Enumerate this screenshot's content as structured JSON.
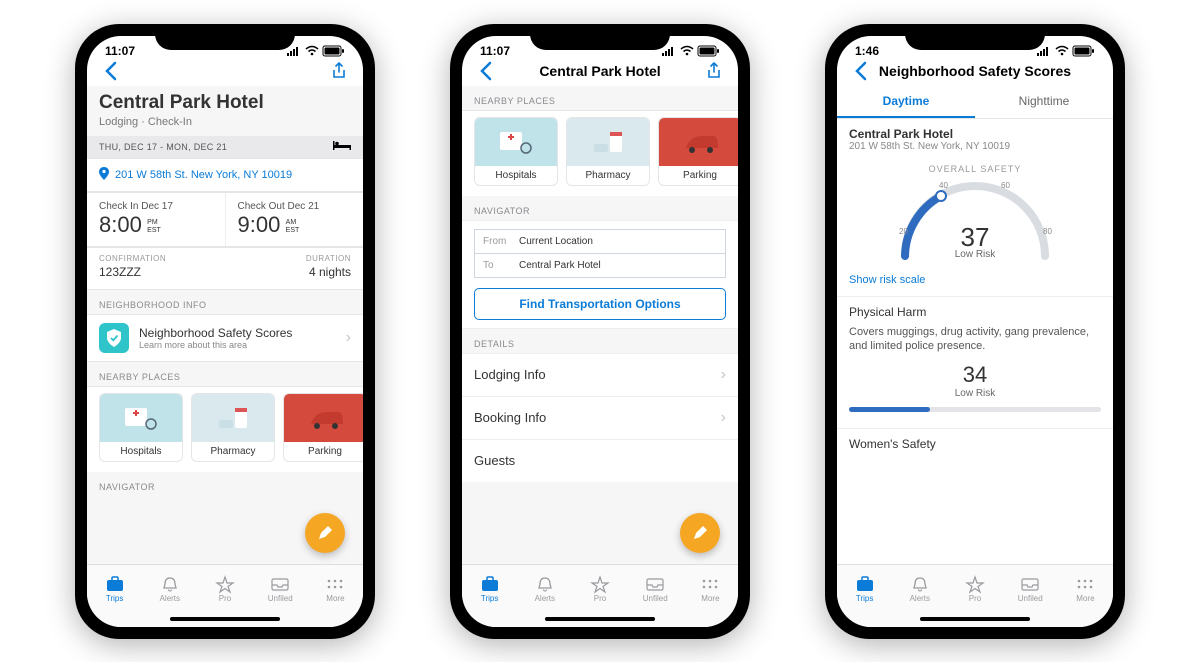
{
  "status": {
    "time_a": "11:07",
    "time_b": "11:07",
    "time_c": "1:46"
  },
  "screen1": {
    "title": "Central Park Hotel",
    "subtitle": "Lodging · Check-In",
    "date_strip": "THU, DEC 17 - MON, DEC 21",
    "address": "201 W 58th St. New York, NY 10019",
    "checkin_label": "Check In Dec 17",
    "checkin_time": "8:00",
    "checkin_ampm": "PM",
    "checkin_tz": "EST",
    "checkout_label": "Check Out Dec 21",
    "checkout_time": "9:00",
    "checkout_ampm": "AM",
    "checkout_tz": "EST",
    "confirmation_label": "CONFIRMATION",
    "confirmation_value": "123ZZZ",
    "duration_label": "DURATION",
    "duration_value": "4 nights",
    "neighborhood_header": "NEIGHBORHOOD INFO",
    "neighborhood_title": "Neighborhood Safety Scores",
    "neighborhood_sub": "Learn more about this area",
    "nearby_header": "NEARBY PLACES",
    "places": {
      "a": "Hospitals",
      "b": "Pharmacy",
      "c": "Parking"
    },
    "navigator_header": "NAVIGATOR"
  },
  "screen2": {
    "nav_title": "Central Park Hotel",
    "nearby_header": "NEARBY PLACES",
    "places": {
      "a": "Hospitals",
      "b": "Pharmacy",
      "c": "Parking"
    },
    "navigator_header": "NAVIGATOR",
    "from_label": "From",
    "from_value": "Current Location",
    "to_label": "To",
    "to_value": "Central Park Hotel",
    "find_button": "Find Transportation Options",
    "details_header": "DETAILS",
    "details": {
      "a": "Lodging Info",
      "b": "Booking Info",
      "c": "Guests"
    }
  },
  "screen3": {
    "nav_title": "Neighborhood Safety Scores",
    "tab_day": "Daytime",
    "tab_night": "Nighttime",
    "hotel_name": "Central Park Hotel",
    "hotel_addr": "201 W 58th St. New York, NY 10019",
    "overall_label": "OVERALL SAFETY",
    "overall_value": "37",
    "overall_risk": "Low Risk",
    "scale_ticks": {
      "a": "20",
      "b": "40",
      "c": "60",
      "d": "80"
    },
    "scale_link": "Show risk scale",
    "harm_title": "Physical Harm",
    "harm_desc": "Covers muggings, drug activity, gang prevalence, and limited police presence.",
    "harm_value": "34",
    "harm_risk": "Low Risk",
    "women_title": "Women's Safety"
  },
  "tabbar": {
    "trips": "Trips",
    "alerts": "Alerts",
    "pro": "Pro",
    "unfiled": "Unfiled",
    "more": "More"
  }
}
